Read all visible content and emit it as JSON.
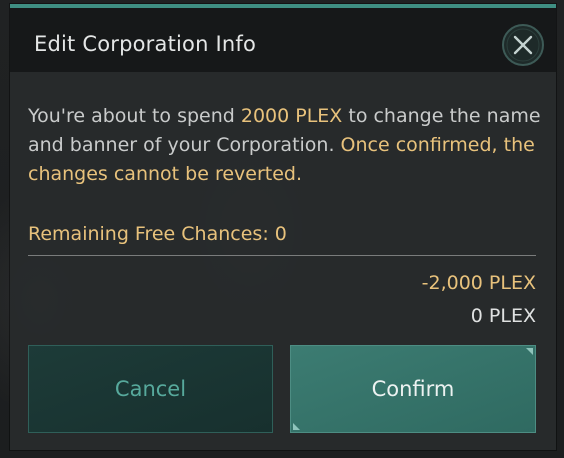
{
  "dialog": {
    "title": "Edit Corporation Info",
    "close_icon": "close-x-icon",
    "message": {
      "part1": "You're about to spend ",
      "plex_amount": "2000 PLEX",
      "part2": " to change the name and banner of your Corporation. ",
      "warning": "Once confirmed, the changes cannot be reverted."
    },
    "remaining_free_chances": "Remaining Free Chances: 0",
    "cost": "-2,000 PLEX",
    "balance": "0 PLEX",
    "cancel_label": "Cancel",
    "confirm_label": "Confirm"
  },
  "colors": {
    "accent_teal": "#3f8f83",
    "highlight_gold": "#e8c27c",
    "text_light": "#c9cbcb"
  }
}
